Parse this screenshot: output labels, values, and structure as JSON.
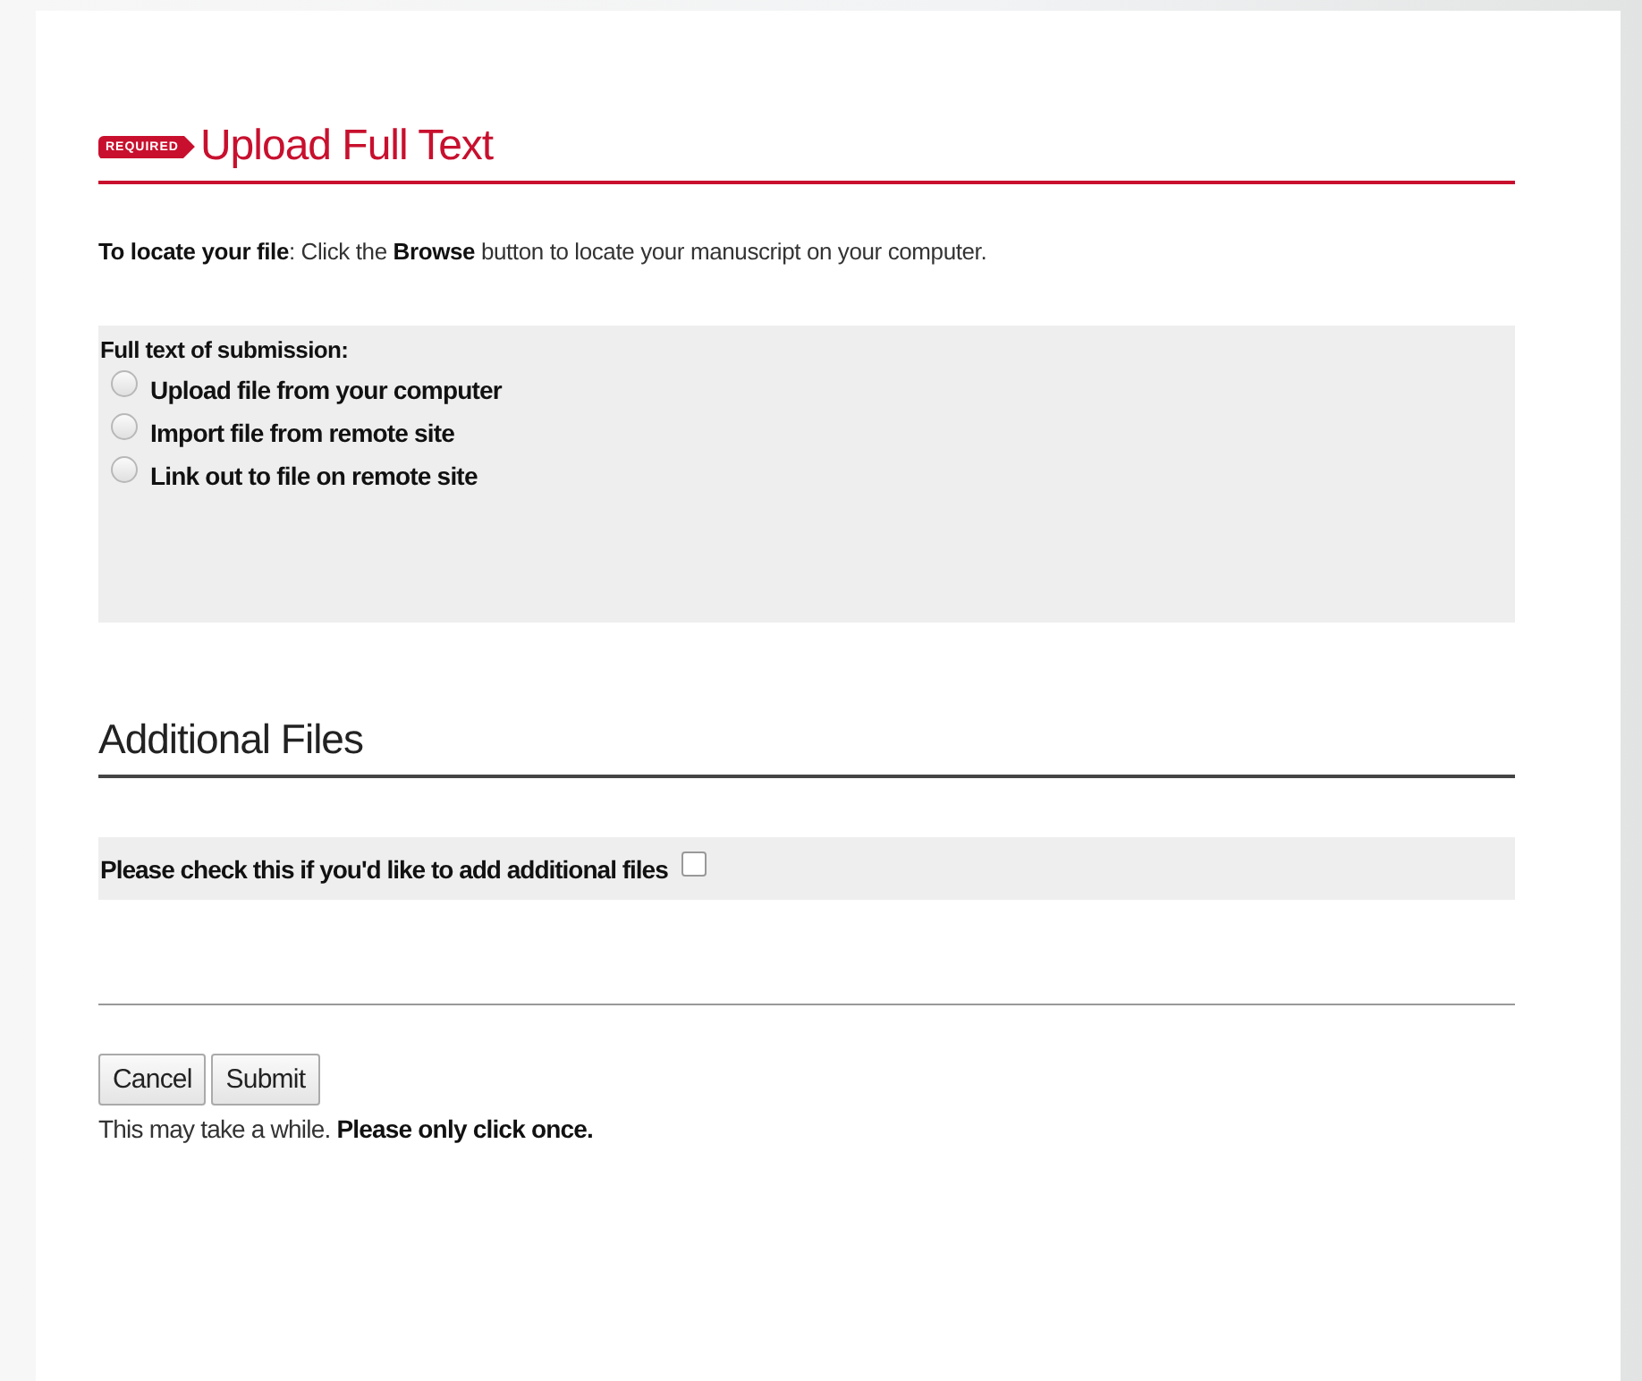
{
  "section": {
    "badge": "REQUIRED",
    "title": "Upload Full Text"
  },
  "instruction": "**To locate your file**: Click the **Browse** button to locate your manuscript on your computer.",
  "full_text": {
    "label": "Full text of submission:",
    "options": [
      {
        "label": "Upload file from your computer",
        "selected": false
      },
      {
        "label": "Import file from remote site",
        "selected": false
      },
      {
        "label": "Link out to file on remote site",
        "selected": false
      }
    ]
  },
  "additional": {
    "title": "Additional Files",
    "checkbox_label": "Please check this if you'd like to add additional files",
    "checked": false
  },
  "buttons": [
    "Cancel",
    "Submit"
  ],
  "note": "This may take a while. **Please only click once.**"
}
